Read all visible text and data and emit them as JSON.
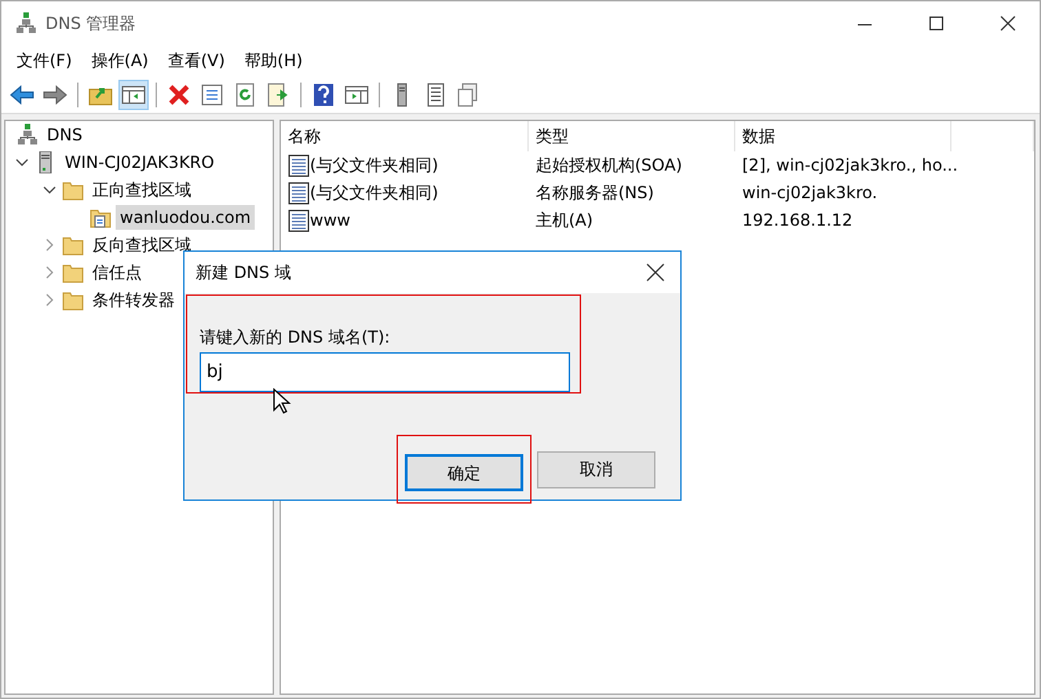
{
  "window": {
    "title": "DNS 管理器"
  },
  "menu": [
    "文件(F)",
    "操作(A)",
    "查看(V)",
    "帮助(H)"
  ],
  "toolbar": [
    {
      "kind": "back"
    },
    {
      "kind": "forward"
    },
    {
      "kind": "separator"
    },
    {
      "kind": "up"
    },
    {
      "kind": "tree",
      "pressed": true
    },
    {
      "kind": "separator"
    },
    {
      "kind": "delete"
    },
    {
      "kind": "properties"
    },
    {
      "kind": "refresh"
    },
    {
      "kind": "export"
    },
    {
      "kind": "separator"
    },
    {
      "kind": "help"
    },
    {
      "kind": "pane"
    },
    {
      "kind": "separator"
    },
    {
      "kind": "server"
    },
    {
      "kind": "list"
    },
    {
      "kind": "pages"
    }
  ],
  "tree": [
    {
      "label": "DNS",
      "kind": "root",
      "selected": false,
      "children": [
        {
          "label": "WIN-CJ02JAK3KRO",
          "kind": "server",
          "expanded": true,
          "selected": false,
          "children": [
            {
              "label": "正向查找区域",
              "kind": "folder",
              "expanded": true,
              "selected": false,
              "children": [
                {
                  "label": "wanluodou.com",
                  "kind": "zone",
                  "selected": true
                }
              ]
            },
            {
              "label": "反向查找区域",
              "kind": "folder",
              "expanded": false,
              "selected": false
            },
            {
              "label": "信任点",
              "kind": "folder",
              "expanded": false,
              "selected": false
            },
            {
              "label": "条件转发器",
              "kind": "folder",
              "expanded": false,
              "selected": false
            }
          ]
        }
      ]
    }
  ],
  "table": {
    "columns": [
      "名称",
      "类型",
      "数据"
    ],
    "rows": [
      [
        "(与父文件夹相同)",
        "起始授权机构(SOA)",
        "[2], win-cj02jak3kro., ho..."
      ],
      [
        "(与父文件夹相同)",
        "名称服务器(NS)",
        "win-cj02jak3kro."
      ],
      [
        "www",
        "主机(A)",
        "192.168.1.12"
      ]
    ]
  },
  "dialog": {
    "title": "新建 DNS 域",
    "label": "请键入新的 DNS 域名(T):",
    "value": "bj",
    "field_highlighted": true,
    "buttons": [
      {
        "label": "确定",
        "default": true,
        "highlighted": true
      },
      {
        "label": "取消",
        "default": false,
        "highlighted": false
      }
    ]
  }
}
